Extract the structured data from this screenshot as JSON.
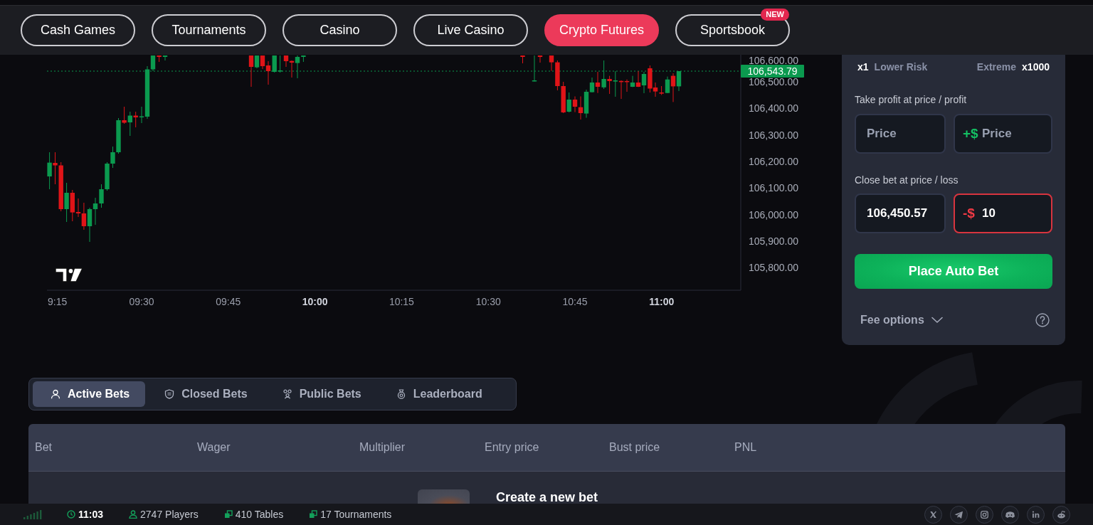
{
  "nav": {
    "tabs": [
      {
        "label": "Cash Games",
        "selected": false
      },
      {
        "label": "Tournaments",
        "selected": false
      },
      {
        "label": "Casino",
        "selected": false
      },
      {
        "label": "Live Casino",
        "selected": false
      },
      {
        "label": "Crypto Futures",
        "selected": true
      },
      {
        "label": "Sportsbook",
        "selected": false,
        "badge": "NEW"
      }
    ]
  },
  "chart": {
    "price_scale": [
      "106,600.00",
      "106,500.00",
      "106,400.00",
      "106,300.00",
      "106,200.00",
      "106,100.00",
      "106,000.00",
      "105,900.00",
      "105,800.00"
    ],
    "current_price": "106,543.79",
    "time_scale": [
      {
        "label": "9:15",
        "major": false
      },
      {
        "label": "09:30",
        "major": false
      },
      {
        "label": "09:45",
        "major": false
      },
      {
        "label": "10:00",
        "major": true
      },
      {
        "label": "10:15",
        "major": false
      },
      {
        "label": "10:30",
        "major": false
      },
      {
        "label": "10:45",
        "major": false
      },
      {
        "label": "11:00",
        "major": true
      }
    ]
  },
  "order_panel": {
    "leverage": {
      "min": {
        "value": "x1",
        "label": "Lower Risk"
      },
      "max": {
        "label": "Extreme",
        "value": "x1000"
      }
    },
    "take_profit": {
      "label": "Take profit at price / profit",
      "fields": [
        {
          "kind": "price",
          "placeholder": "Price"
        },
        {
          "kind": "profit",
          "prefix": "+$",
          "placeholder": "Price"
        }
      ]
    },
    "stop_loss": {
      "label": "Close bet at price / loss",
      "fields": [
        {
          "kind": "price",
          "value": "106,450.57"
        },
        {
          "kind": "loss",
          "prefix": "-$",
          "value": "10"
        }
      ]
    },
    "submit_button": "Place Auto Bet",
    "fee_options": {
      "label": "Fee options",
      "expanded": false
    }
  },
  "bets": {
    "tabs": [
      {
        "kind": "active",
        "label": "Active Bets",
        "selected": true
      },
      {
        "kind": "closed",
        "label": "Closed Bets",
        "selected": false
      },
      {
        "kind": "public",
        "label": "Public Bets",
        "selected": false
      },
      {
        "kind": "leaderboard",
        "label": "Leaderboard",
        "selected": false
      }
    ],
    "table": {
      "columns": [
        "Bet",
        "Wager",
        "Multiplier",
        "Entry price",
        "Bust price",
        "PNL"
      ],
      "empty_message": "Create a new bet"
    }
  },
  "status_bar": {
    "items": [
      {
        "kind": "time",
        "text": "11:03"
      },
      {
        "kind": "players",
        "text": "2747 Players"
      },
      {
        "kind": "tables",
        "text": "410 Tables"
      },
      {
        "kind": "tournaments",
        "text": "17 Tournaments"
      }
    ]
  }
}
